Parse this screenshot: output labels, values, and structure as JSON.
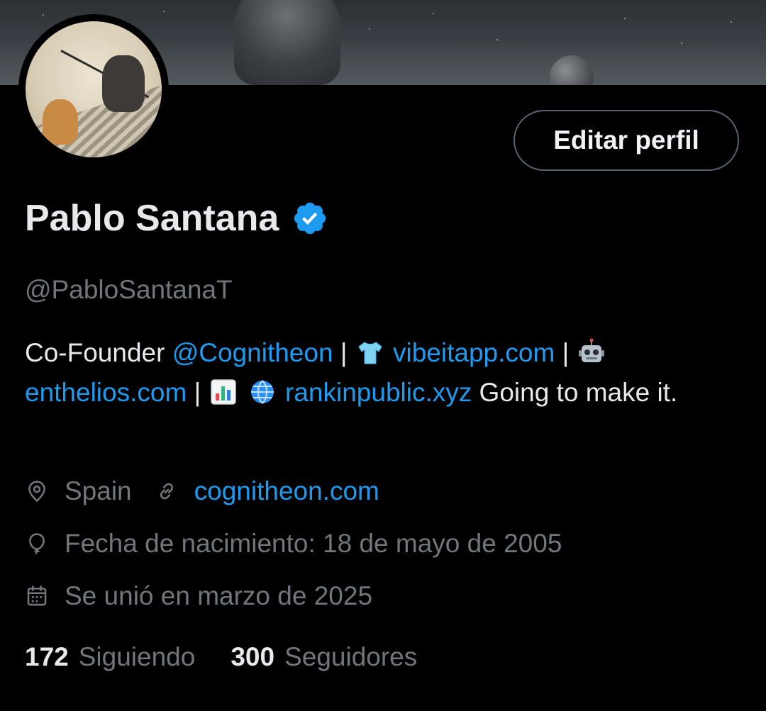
{
  "profile": {
    "display_name": "Pablo Santana",
    "handle": "@PabloSantanaT",
    "edit_button_label": "Editar perfil",
    "verified_color": "#1d9bf0"
  },
  "bio": {
    "prefix": "Co-Founder ",
    "mention": "@Cognitheon",
    "sep1": "  | ",
    "link1": "vibeitapp.com",
    "sep2": " | ",
    "link2": "enthelios.com",
    "sep3": " | ",
    "link3": "rankinpublic.xyz",
    "suffix": "  Going to make it."
  },
  "meta": {
    "location": "Spain",
    "website": "cognitheon.com",
    "birthday": "Fecha de nacimiento: 18 de mayo de 2005",
    "joined": "Se unió en marzo de 2025"
  },
  "stats": {
    "following_count": "172",
    "following_label": "Siguiendo",
    "followers_count": "300",
    "followers_label": "Seguidores"
  },
  "colors": {
    "background": "#000000",
    "text_primary": "#e7e9ea",
    "text_secondary": "#71767b",
    "link": "#1d9bf0"
  }
}
